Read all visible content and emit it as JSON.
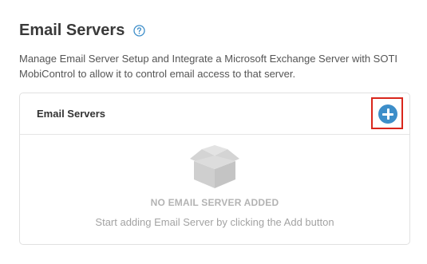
{
  "header": {
    "title": "Email Servers",
    "help_icon": "question-circle-icon"
  },
  "description": "Manage Email Server Setup and Integrate a Microsoft Exchange Server with SOTI MobiControl to allow it to control email access to that server.",
  "panel": {
    "title": "Email Servers",
    "add_icon": "plus-circle-icon",
    "empty_state": {
      "icon": "empty-box-icon",
      "title": "NO EMAIL SERVER ADDED",
      "subtitle": "Start adding Email Server by clicking the Add button"
    }
  },
  "colors": {
    "accent": "#3d8ec9",
    "highlight": "#d9261c",
    "empty_icon": "#d4d4d4"
  }
}
